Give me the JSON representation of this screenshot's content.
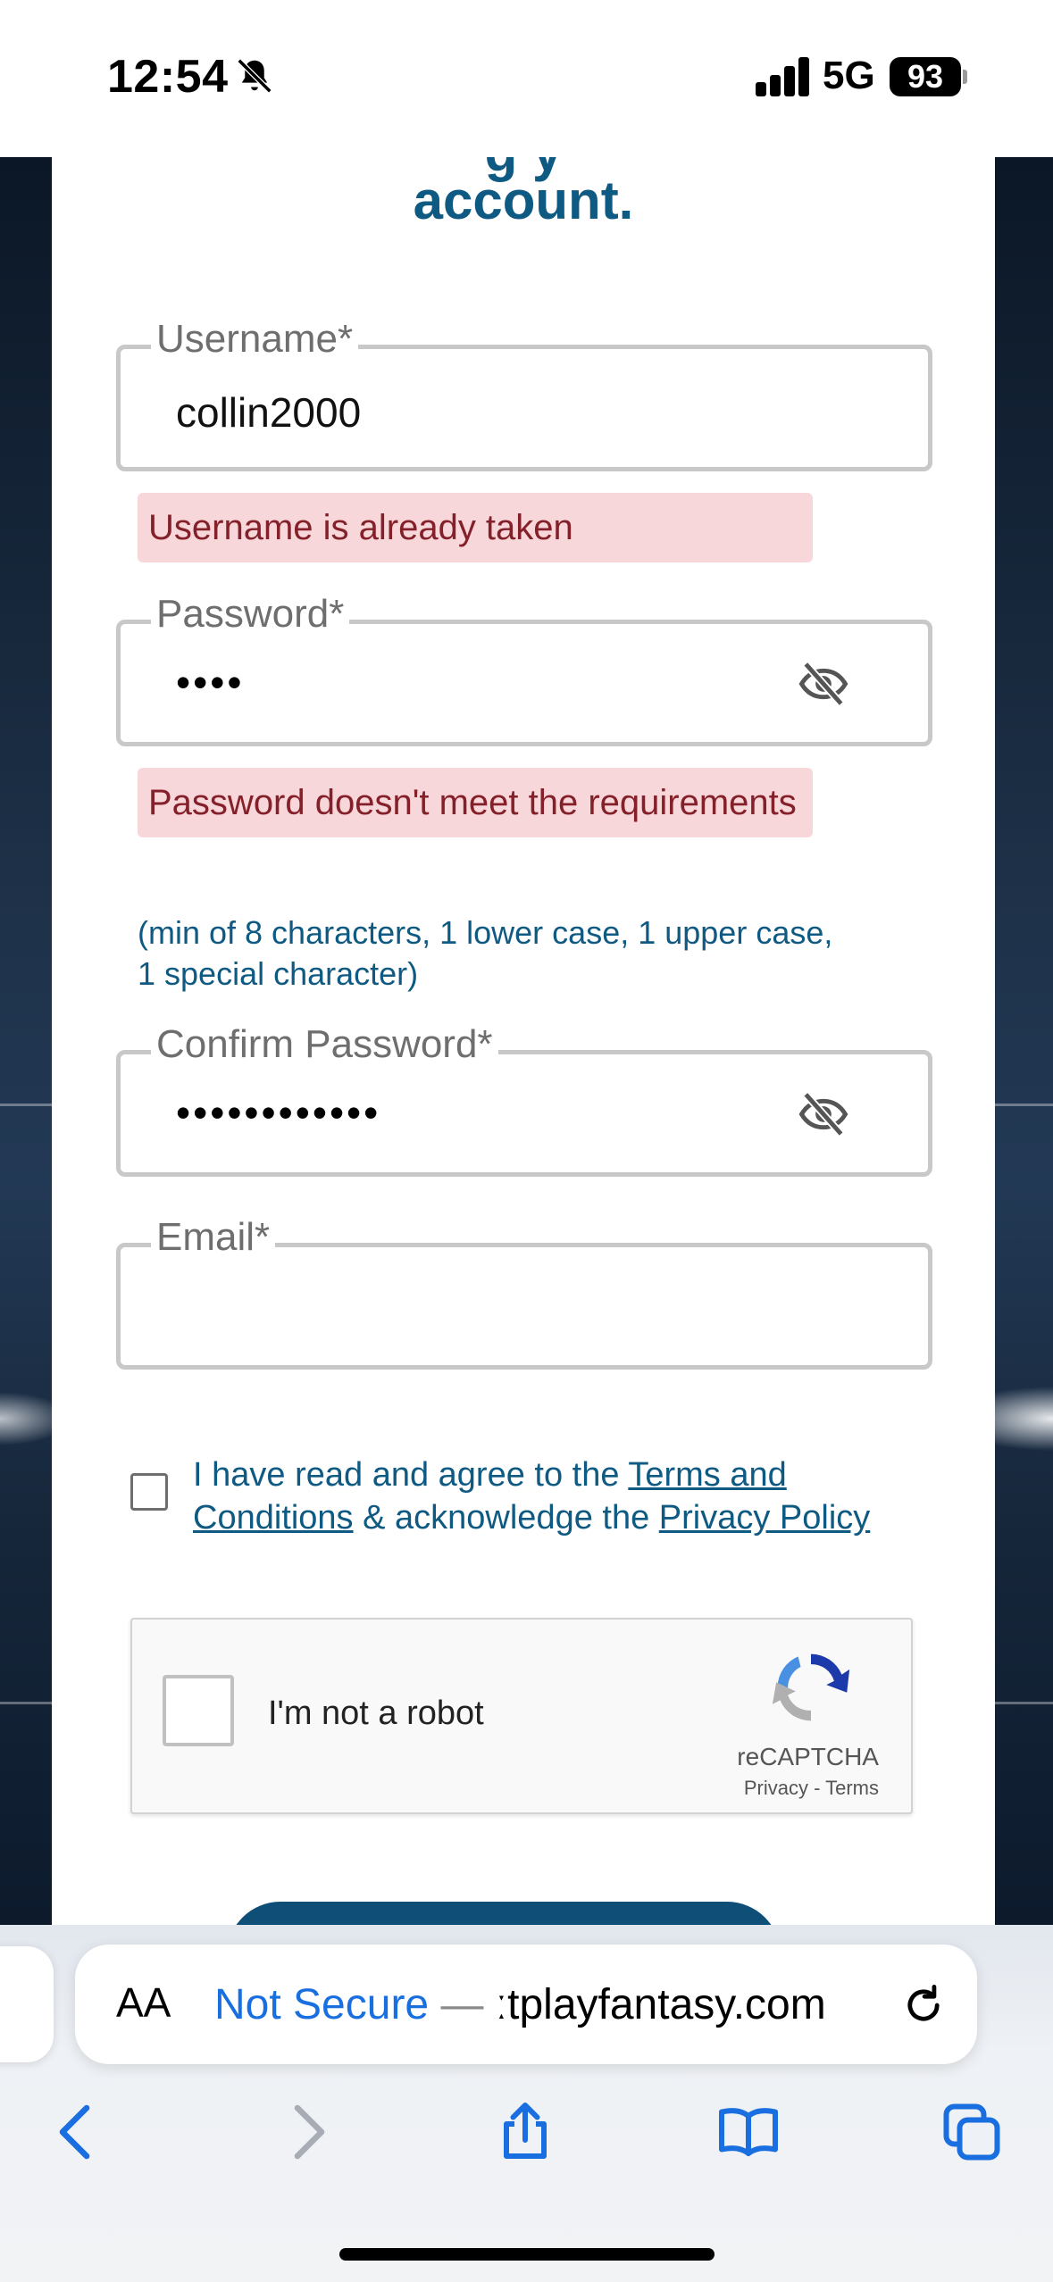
{
  "status_bar": {
    "time": "12:54",
    "network": "5G",
    "battery": "93",
    "icons": [
      "bell-slash-icon",
      "signal-icon",
      "battery-icon"
    ]
  },
  "form": {
    "heading_fragment": "g y",
    "heading": "account.",
    "username": {
      "label": "Username*",
      "value": "collin2000",
      "error": "Username is already taken"
    },
    "password": {
      "label": "Password*",
      "value": "••••",
      "error": "Password doesn't meet the requirements",
      "hint": "(min of 8 characters, 1 lower case, 1 upper case, 1 special character)"
    },
    "confirm_password": {
      "label": "Confirm Password*",
      "value": "••••••••••••"
    },
    "email": {
      "label": "Email*",
      "value": ""
    },
    "agree": {
      "text_before": "I have read and agree to the ",
      "terms_link": "Terms and Conditions",
      "text_middle": " & acknowledge the ",
      "privacy_link": "Privacy Policy"
    },
    "recaptcha": {
      "label": "I'm not a robot",
      "brand": "reCAPTCHA",
      "links": "Privacy - Terms"
    }
  },
  "safari": {
    "aa_label": "AA",
    "url_prefix": "Not Secure",
    "url_separator": " — ",
    "url_domain": "ːtplayfantasy.com",
    "toolbar": [
      "back-icon",
      "forward-icon",
      "share-icon",
      "bookmarks-icon",
      "tabs-icon"
    ]
  },
  "colors": {
    "accent": "#0f5a82",
    "error_bg": "#f8d7da",
    "error_text": "#842029",
    "link_blue": "#1a6fe0"
  }
}
